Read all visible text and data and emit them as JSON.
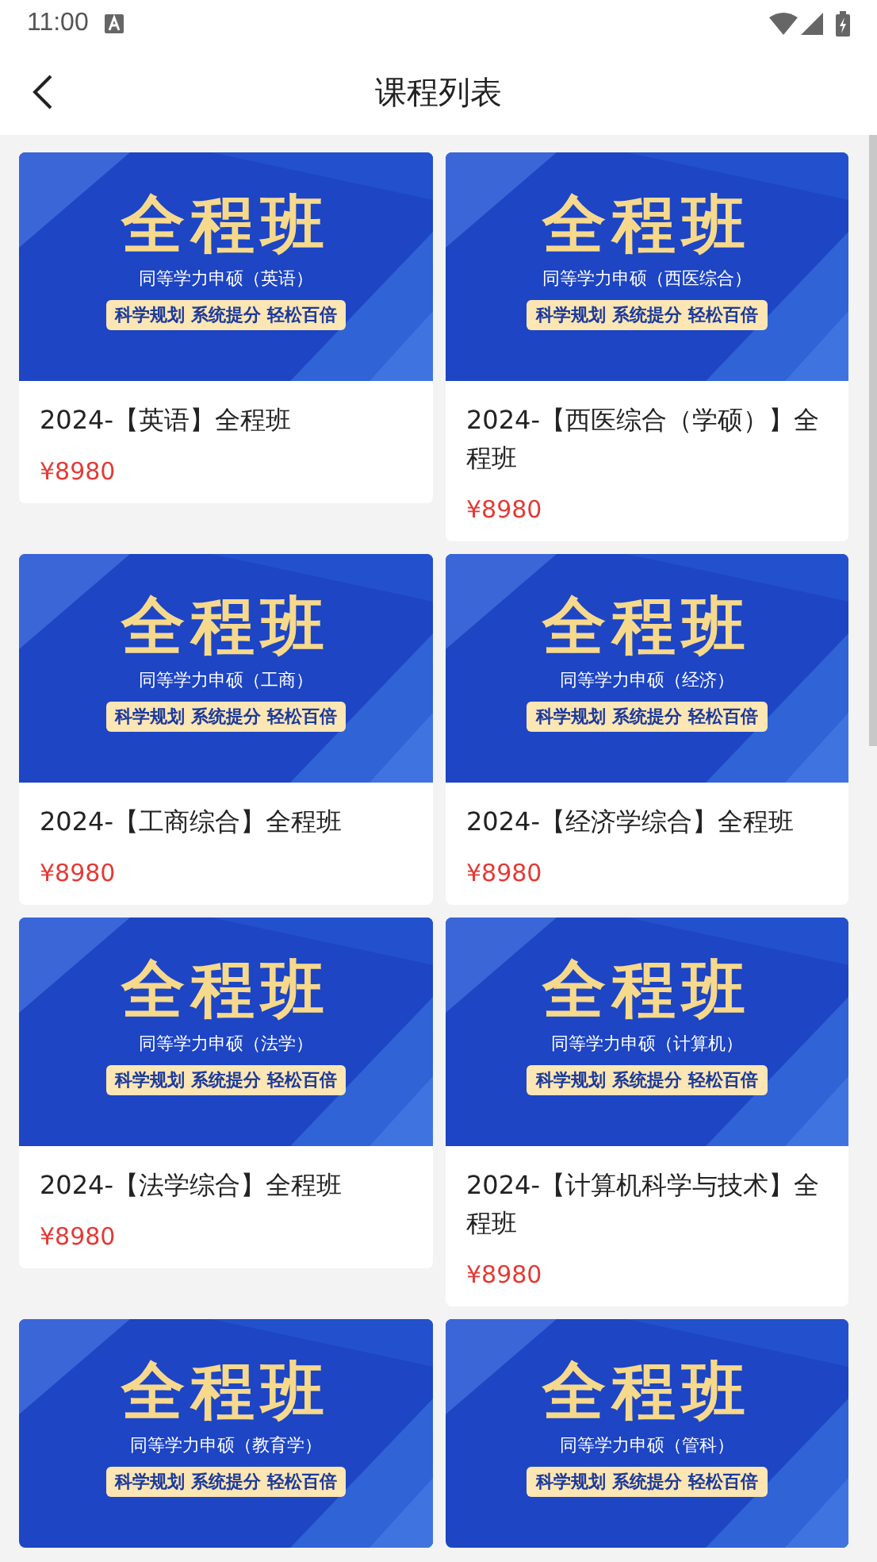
{
  "status_bar": {
    "time": "11:00"
  },
  "header": {
    "title": "课程列表"
  },
  "courses": [
    {
      "banner": {
        "title": "全程班",
        "subtitle": "同等学力申硕（英语）",
        "tagline": "科学规划 系统提分 轻松百倍"
      },
      "name": "2024-【英语】全程班",
      "price": "¥8980"
    },
    {
      "banner": {
        "title": "全程班",
        "subtitle": "同等学力申硕（西医综合）",
        "tagline": "科学规划 系统提分 轻松百倍"
      },
      "name": "2024-【西医综合（学硕）】全程班",
      "price": "¥8980"
    },
    {
      "banner": {
        "title": "全程班",
        "subtitle": "同等学力申硕（工商）",
        "tagline": "科学规划 系统提分 轻松百倍"
      },
      "name": "2024-【工商综合】全程班",
      "price": "¥8980"
    },
    {
      "banner": {
        "title": "全程班",
        "subtitle": "同等学力申硕（经济）",
        "tagline": "科学规划 系统提分 轻松百倍"
      },
      "name": "2024-【经济学综合】全程班",
      "price": "¥8980"
    },
    {
      "banner": {
        "title": "全程班",
        "subtitle": "同等学力申硕（法学）",
        "tagline": "科学规划 系统提分 轻松百倍"
      },
      "name": "2024-【法学综合】全程班",
      "price": "¥8980"
    },
    {
      "banner": {
        "title": "全程班",
        "subtitle": "同等学力申硕（计算机）",
        "tagline": "科学规划 系统提分 轻松百倍"
      },
      "name": "2024-【计算机科学与技术】全程班",
      "price": "¥8980"
    },
    {
      "banner": {
        "title": "全程班",
        "subtitle": "同等学力申硕（教育学）",
        "tagline": "科学规划 系统提分 轻松百倍"
      }
    },
    {
      "banner": {
        "title": "全程班",
        "subtitle": "同等学力申硕（管科）",
        "tagline": "科学规划 系统提分 轻松百倍"
      }
    }
  ]
}
